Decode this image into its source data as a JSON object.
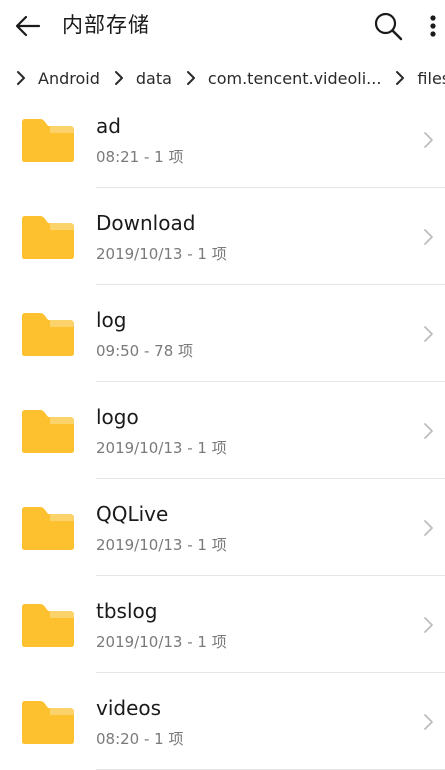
{
  "header": {
    "title": "内部存储",
    "back_icon": "arrow-left-icon",
    "search_icon": "search-icon",
    "more_icon": "more-vertical-icon"
  },
  "breadcrumb": [
    {
      "label": "Android"
    },
    {
      "label": "data"
    },
    {
      "label": "com.tencent.videoli..."
    },
    {
      "label": "files"
    }
  ],
  "folders": [
    {
      "name": "ad",
      "meta": "08:21 - 1 项"
    },
    {
      "name": "Download",
      "meta": "2019/10/13 - 1 项"
    },
    {
      "name": "log",
      "meta": "09:50 - 78 项"
    },
    {
      "name": "logo",
      "meta": "2019/10/13 - 1 项"
    },
    {
      "name": "QQLive",
      "meta": "2019/10/13 - 1 项"
    },
    {
      "name": "tbslog",
      "meta": "2019/10/13 - 1 项"
    },
    {
      "name": "videos",
      "meta": "08:20 - 1 项"
    }
  ],
  "colors": {
    "folder_main": "#FDC02F",
    "folder_tab": "#FBD36A",
    "text_primary": "#1a1a1a",
    "text_secondary": "#7a7a7a",
    "chevron": "#bdbdbd",
    "divider": "#e6e6e6"
  }
}
